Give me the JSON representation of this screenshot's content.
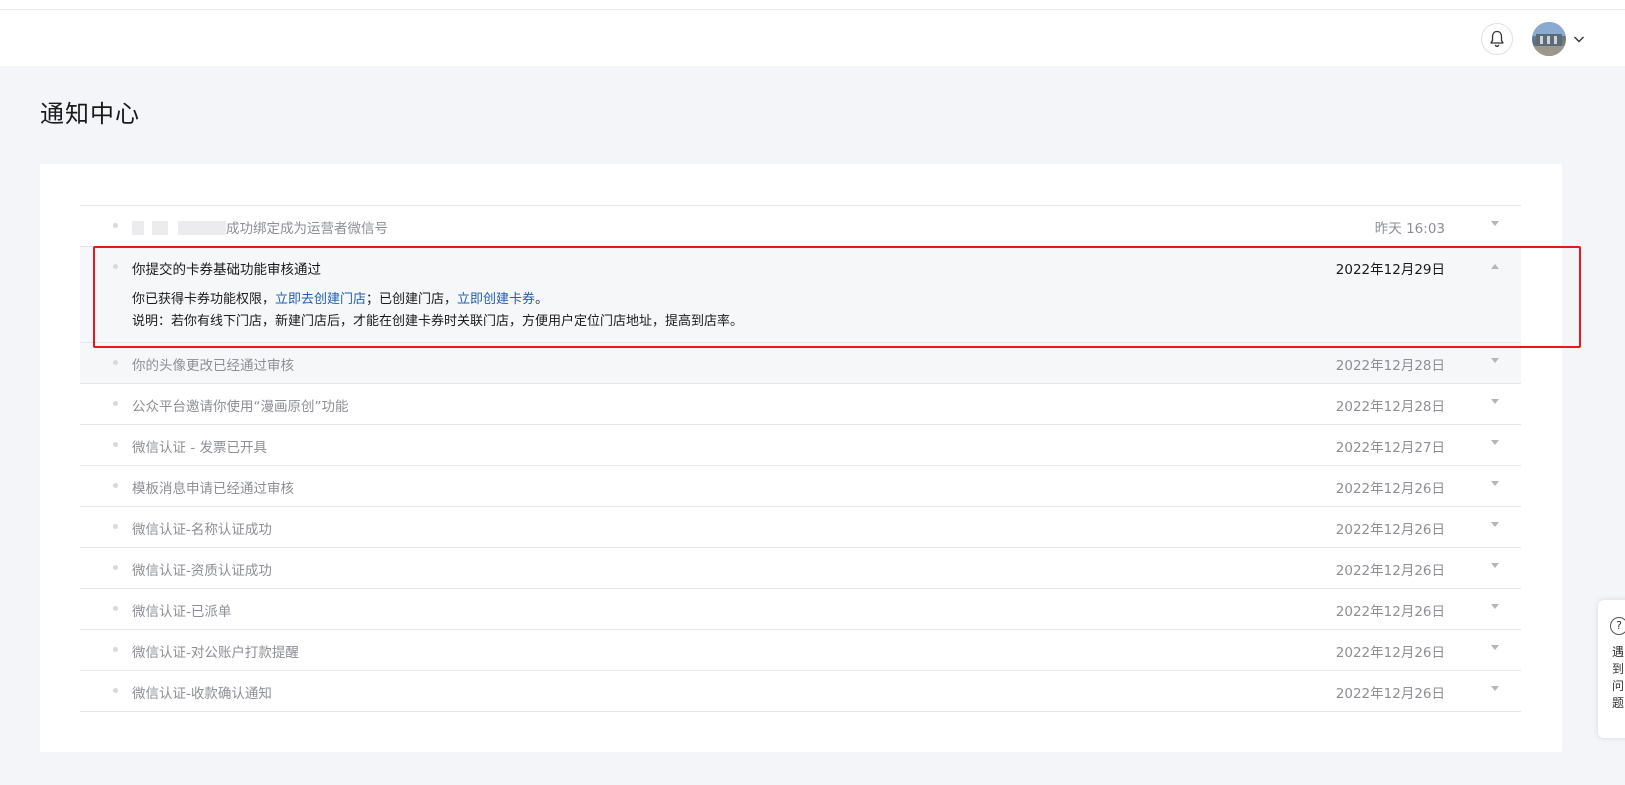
{
  "page": {
    "title": "通知中心"
  },
  "notifications": [
    {
      "title_suffix": "成功绑定成为运营者微信号",
      "date": "昨天 16:03"
    },
    {
      "title": "你提交的卡券基础功能审核通过",
      "date": "2022年12月29日",
      "detail": {
        "line1_text1": "你已获得卡券功能权限，",
        "line1_link1": "立即去创建门店",
        "line1_text2": "；已创建门店，",
        "line1_link2": "立即创建卡券",
        "line1_text3": "。",
        "line2": "说明：若你有线下门店，新建门店后，才能在创建卡券时关联门店，方便用户定位门店地址，提高到店率。"
      }
    },
    {
      "title": "你的头像更改已经通过审核",
      "date": "2022年12月28日"
    },
    {
      "title": "公众平台邀请你使用“漫画原创”功能",
      "date": "2022年12月28日"
    },
    {
      "title": "微信认证 - 发票已开具",
      "date": "2022年12月27日"
    },
    {
      "title": "模板消息申请已经通过审核",
      "date": "2022年12月26日"
    },
    {
      "title": "微信认证-名称认证成功",
      "date": "2022年12月26日"
    },
    {
      "title": "微信认证-资质认证成功",
      "date": "2022年12月26日"
    },
    {
      "title": "微信认证-已派单",
      "date": "2022年12月26日"
    },
    {
      "title": "微信认证-对公账户打款提醒",
      "date": "2022年12月26日"
    },
    {
      "title": "微信认证-收款确认通知",
      "date": "2022年12月26日"
    }
  ],
  "help_widget": {
    "icon": "?",
    "text": "遇到问题"
  },
  "colors": {
    "highlight": "#e8191b",
    "link": "#1f5fb3"
  }
}
